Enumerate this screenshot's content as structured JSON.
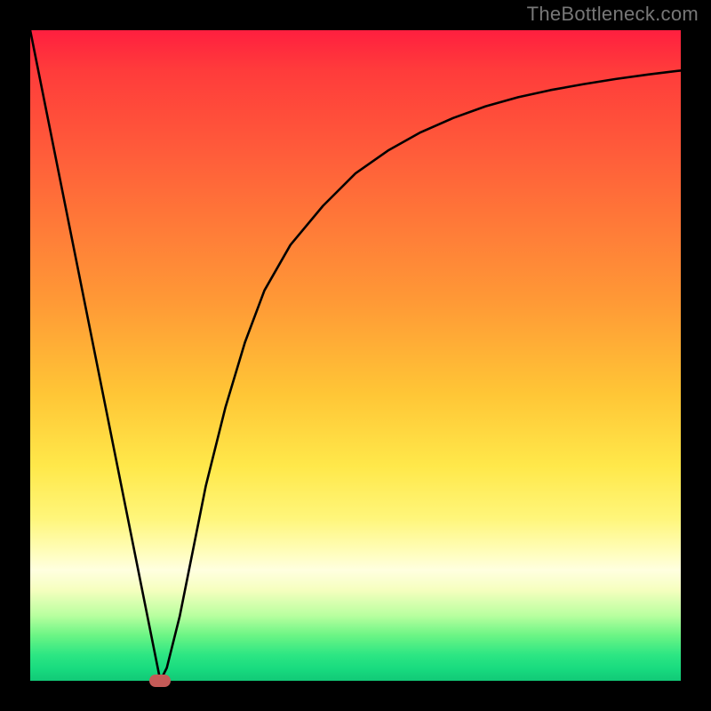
{
  "watermark": "TheBottleneck.com",
  "colors": {
    "frame": "#000000",
    "gradient_top": "#ff1f3f",
    "gradient_bottom": "#12ca77",
    "curve": "#000000",
    "marker": "#c45a57"
  },
  "chart_data": {
    "type": "line",
    "title": "",
    "xlabel": "",
    "ylabel": "",
    "xlim": [
      0,
      100
    ],
    "ylim": [
      0,
      100
    ],
    "curve": {
      "name": "bottleneck-curve",
      "x": [
        0,
        5,
        10,
        15,
        17,
        19,
        20,
        21,
        23,
        25,
        27,
        30,
        33,
        36,
        40,
        45,
        50,
        55,
        60,
        65,
        70,
        75,
        80,
        85,
        90,
        95,
        100
      ],
      "y": [
        100,
        75,
        50,
        25,
        15,
        5,
        0,
        2,
        10,
        20,
        30,
        42,
        52,
        60,
        67,
        73,
        78,
        81.5,
        84.3,
        86.5,
        88.3,
        89.7,
        90.8,
        91.7,
        92.5,
        93.2,
        93.8
      ]
    },
    "marker": {
      "x": 20,
      "y": 0
    },
    "annotations": []
  }
}
